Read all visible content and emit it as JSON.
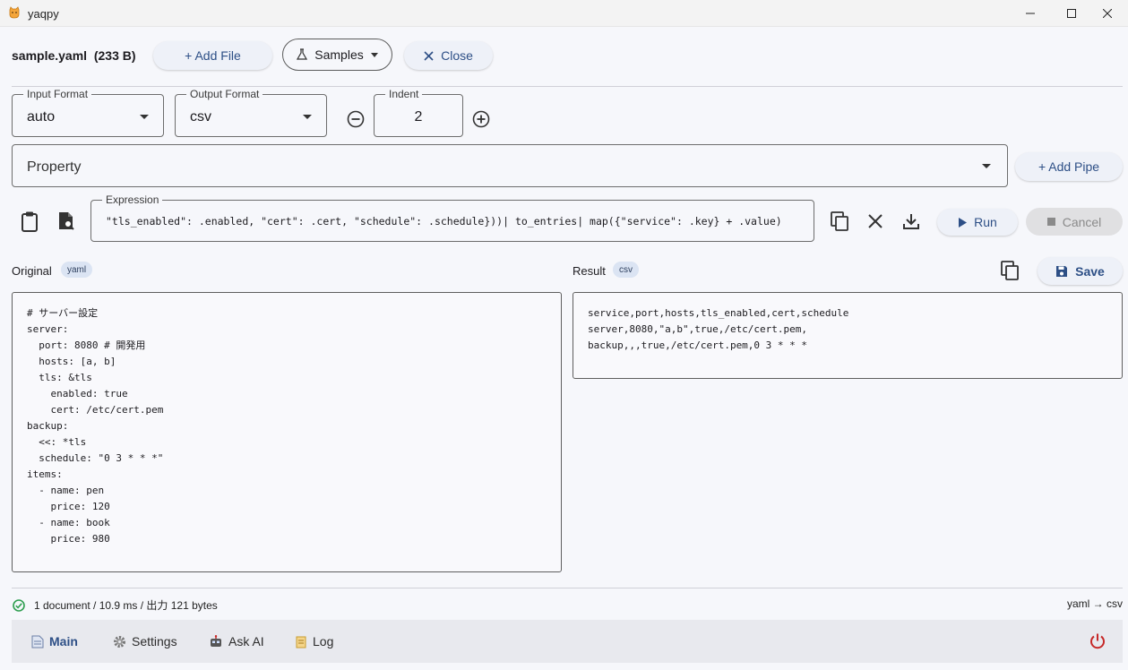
{
  "window": {
    "title": "yaqpy"
  },
  "file": {
    "name": "sample.yaml",
    "size": "(233 B)"
  },
  "toolbar": {
    "add_file": "+ Add File",
    "samples": "Samples",
    "close": "Close"
  },
  "input_format": {
    "label": "Input Format",
    "value": "auto"
  },
  "output_format": {
    "label": "Output Format",
    "value": "csv"
  },
  "indent": {
    "label": "Indent",
    "value": "2"
  },
  "pipe": {
    "value": "Property",
    "add_label": "+ Add Pipe"
  },
  "expression": {
    "label": "Expression",
    "value": "\"tls_enabled\": .enabled, \"cert\": .cert, \"schedule\": .schedule}))| to_entries| map({\"service\": .key} + .value)"
  },
  "actions": {
    "run": "Run",
    "cancel": "Cancel",
    "save": "Save"
  },
  "original": {
    "label": "Original",
    "chip": "yaml",
    "content": "# サーバー設定\nserver:\n  port: 8080 # 開発用\n  hosts: [a, b]\n  tls: &tls\n    enabled: true\n    cert: /etc/cert.pem\nbackup:\n  <<: *tls\n  schedule: \"0 3 * * *\"\nitems:\n  - name: pen\n    price: 120\n  - name: book\n    price: 980"
  },
  "result": {
    "label": "Result",
    "chip": "csv",
    "content": "service,port,hosts,tls_enabled,cert,schedule\nserver,8080,\"a,b\",true,/etc/cert.pem,\nbackup,,,true,/etc/cert.pem,0 3 * * *"
  },
  "status": {
    "text": "1 document / 10.9 ms / 出力 121 bytes",
    "conversion": "yaml → csv"
  },
  "nav": {
    "main": "Main",
    "settings": "Settings",
    "ask_ai": "Ask AI",
    "log": "Log"
  },
  "colors": {
    "accent": "#2d4f86",
    "success": "#2e9e4f",
    "power": "#c62828"
  }
}
